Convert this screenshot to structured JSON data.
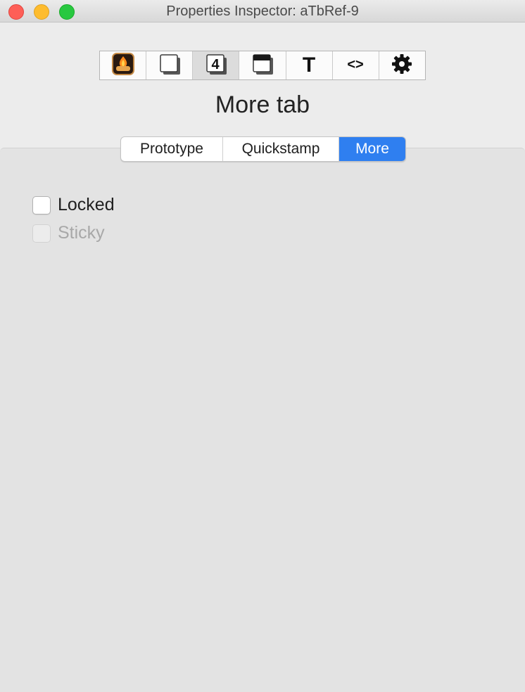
{
  "window": {
    "title": "Properties Inspector: aTbRef-9"
  },
  "toolbar": {
    "buttons": [
      {
        "name": "fire-icon"
      },
      {
        "name": "note-icon"
      },
      {
        "name": "number-4-icon",
        "glyph": "4"
      },
      {
        "name": "window-icon"
      },
      {
        "name": "text-icon",
        "glyph": "T"
      },
      {
        "name": "code-icon",
        "glyph": "<>"
      },
      {
        "name": "gear-icon",
        "glyph": "✱"
      }
    ],
    "selected_index": 2
  },
  "heading": "More tab",
  "tabs": [
    {
      "label": "Prototype"
    },
    {
      "label": "Quickstamp"
    },
    {
      "label": "More"
    }
  ],
  "active_tab": "More",
  "checkboxes": [
    {
      "label": "Locked",
      "checked": false,
      "enabled": true
    },
    {
      "label": "Sticky",
      "checked": false,
      "enabled": false
    }
  ],
  "colors": {
    "accent": "#2f7ff0",
    "close": "#fe5f57",
    "minimize": "#febc2e",
    "zoom": "#28c840"
  }
}
